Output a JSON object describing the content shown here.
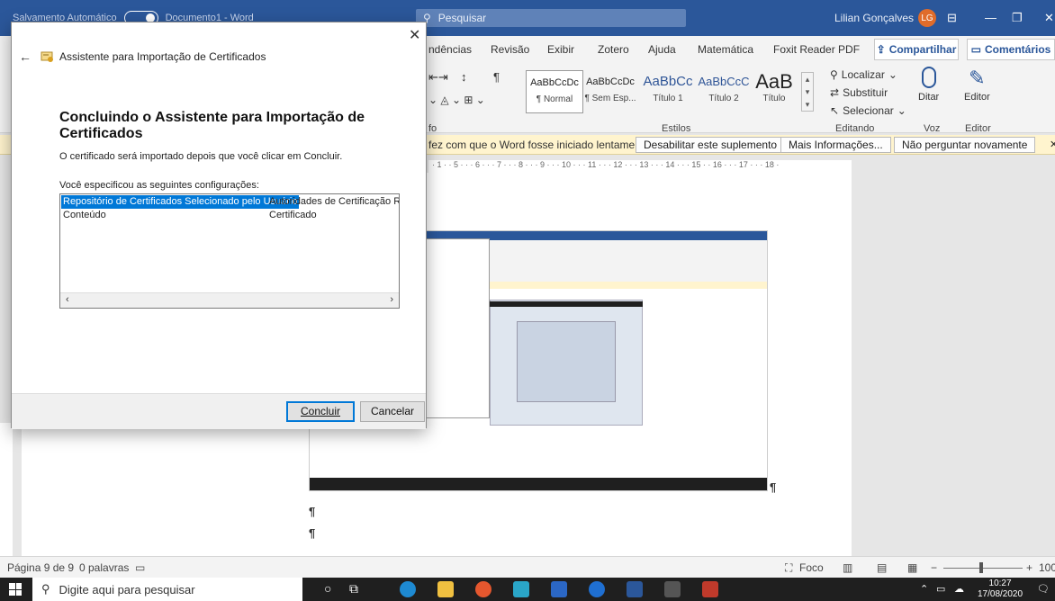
{
  "titlebar": {
    "autosave": "Salvamento Automático",
    "doc_title": "Documento1 - Word",
    "search_placeholder": "Pesquisar",
    "user_name": "Lilian Gonçalves",
    "user_initials": "LG"
  },
  "ribbon_tabs": [
    "ndências",
    "Revisão",
    "Exibir",
    "Zotero",
    "Ajuda",
    "Matemática",
    "Foxit Reader PDF"
  ],
  "share_label": "Compartilhar",
  "comments_label": "Comentários",
  "styles": [
    {
      "sample": "AaBbCcDc",
      "name": "¶ Normal"
    },
    {
      "sample": "AaBbCcDc",
      "name": "¶ Sem Esp..."
    },
    {
      "sample": "AaBbCc",
      "name": "Título 1"
    },
    {
      "sample": "AaBbCcC",
      "name": "Título 2"
    },
    {
      "sample": "AaB",
      "name": "Título"
    }
  ],
  "groups": {
    "fonte": "fo",
    "estilos": "Estilos",
    "editando": "Editando",
    "voz": "Voz",
    "editor": "Editor"
  },
  "editing": {
    "localizar": "Localizar",
    "substituir": "Substituir",
    "selecionar": "Selecionar"
  },
  "big_buttons": {
    "ditar": "Ditar",
    "editor": "Editor"
  },
  "message_bar": {
    "text": "fez com que o Word fosse iniciado lentamente.",
    "disable": "Desabilitar este suplemento",
    "more_info": "Mais Informações...",
    "dont_ask": "Não perguntar novamente"
  },
  "ruler_text": "· 1 · · 5 · · · 6 · · · 7 · · · 8 · · · 9 · · · 10 · · · 11 · · · 12 · · · 13 · · · 14 · · · 15 · · 16 · · · 17 · · · 18 ·",
  "pilcrow": "¶",
  "statusbar": {
    "page": "Página 9 de 9",
    "words": "0 palavras",
    "focus": "Foco",
    "zoom": "100"
  },
  "taskbar": {
    "search_placeholder": "Digite aqui para pesquisar",
    "time": "10:27",
    "date": "17/08/2020"
  },
  "dialog": {
    "window_title": "Assistente para Importação de Certificados",
    "heading": "Concluindo o Assistente para Importação de Certificados",
    "info": "O certificado será importado depois que você clicar em Concluir.",
    "settings_label": "Você especificou as seguintes configurações:",
    "rows": [
      {
        "name": "Repositório de Certificados Selecionado pelo Usuário",
        "value": "Autoridades de Certificação Raiz C"
      },
      {
        "name": "Conteúdo",
        "value": "Certificado"
      }
    ],
    "finish": "Concluir",
    "cancel": "Cancelar"
  },
  "colors": {
    "word_blue": "#2b579a",
    "selection": "#0078d7",
    "message_bar": "#fff4ce"
  }
}
